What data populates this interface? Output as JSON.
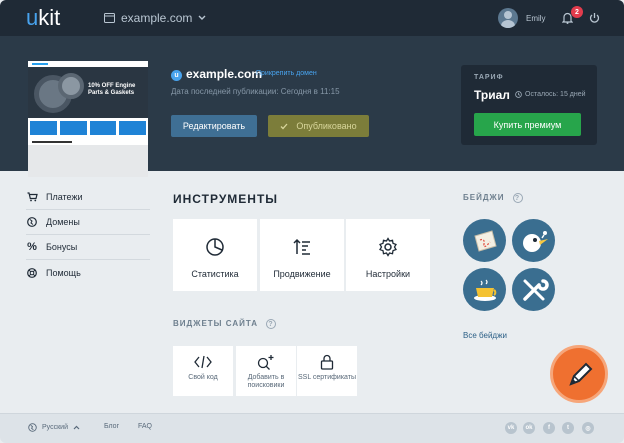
{
  "header": {
    "logo_prefix": "u",
    "logo_suffix": "kit",
    "site_selector": "example.com",
    "user_name": "Emily",
    "notifications_count": "2"
  },
  "site": {
    "name": "example.com",
    "attach_domain": "Прикрепить домен",
    "last_published": "Дата последней публикации: Сегодня в 11:15",
    "edit_button": "Редактировать",
    "published_button": "Опубликовано",
    "thumbnail_text": "10% OFF Engine Parts & Gaskets",
    "icon_letter": "u"
  },
  "plan": {
    "label": "ТАРИФ",
    "name": "Триал",
    "remaining": "Осталось: 15 дней",
    "buy_button": "Купить премиум"
  },
  "sidebar": {
    "items": [
      {
        "label": "Платежи",
        "icon": "cart-icon"
      },
      {
        "label": "Домены",
        "icon": "globe-icon"
      },
      {
        "label": "Бонусы",
        "icon": "percent-icon"
      },
      {
        "label": "Помощь",
        "icon": "lifebuoy-icon"
      }
    ]
  },
  "tools": {
    "title": "ИНСТРУМЕНТЫ",
    "items": [
      {
        "label": "Статистика",
        "icon": "pie-chart-icon"
      },
      {
        "label": "Продвижение",
        "icon": "sort-icon"
      },
      {
        "label": "Настройки",
        "icon": "gear-icon"
      }
    ]
  },
  "widgets": {
    "title": "ВИДЖЕТЫ САЙТА",
    "help": "?",
    "items": [
      {
        "label": "Свой код",
        "icon": "code-icon"
      },
      {
        "label": "Добавить в поисковики",
        "icon": "search-plus-icon"
      },
      {
        "label": "SSL сертификаты",
        "icon": "lock-icon"
      }
    ]
  },
  "badges": {
    "title": "БЕЙДЖИ",
    "help": "?",
    "all_link": "Все бейджи",
    "items": [
      "map-badge",
      "bird-badge",
      "coffee-badge",
      "tools-badge"
    ]
  },
  "footer": {
    "language": "Русский",
    "blog": "Блог",
    "faq": "FAQ",
    "social": [
      "vk-icon",
      "ok-icon",
      "facebook-icon",
      "twitter-icon",
      "instagram-icon"
    ]
  },
  "colors": {
    "nav_bg": "#1f2a36",
    "hero_bg": "#2b3a48",
    "accent_blue": "#48a3ee",
    "buy_green": "#27a54b",
    "badge_blue": "#3a6e90",
    "pencil_orange": "#ef7030"
  }
}
